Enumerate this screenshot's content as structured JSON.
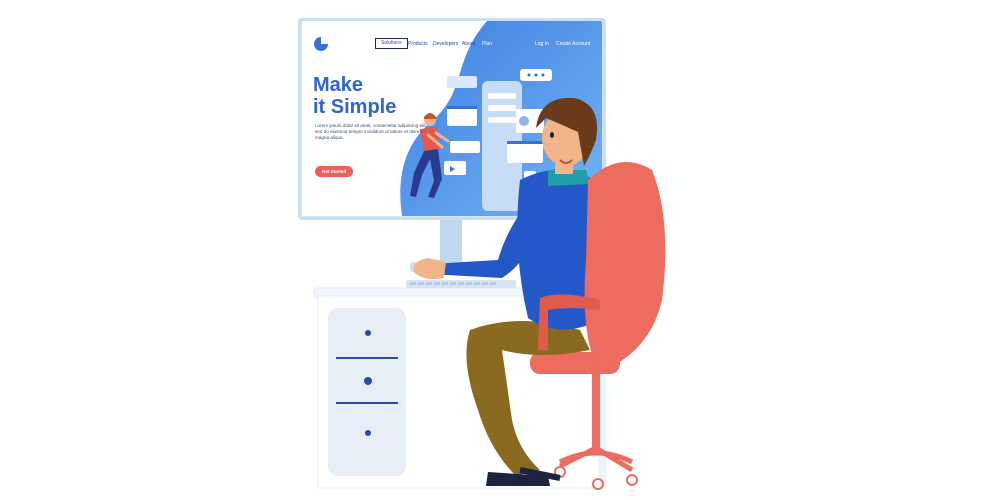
{
  "illustration": {
    "description_role": "person sitting at desk using computer"
  },
  "screen": {
    "nav": {
      "items": [
        {
          "label": "Solutions",
          "active": true
        },
        {
          "label": "Products",
          "active": false
        },
        {
          "label": "Developers",
          "active": false
        },
        {
          "label": "About",
          "active": false
        },
        {
          "label": "Plan",
          "active": false
        }
      ],
      "login": "Log In",
      "create_account": "Create Account"
    },
    "hero": {
      "title_line1": "Make",
      "title_line2": "it Simple",
      "body": "Lorem ipsum dolor sit amet, consectetur adipiscing elit, sed do eiusmod tempor incididunt ut labore et dolore magna aliqua.",
      "cta_label": "Get Started"
    }
  },
  "colors": {
    "accent_blue": "#2f64d6",
    "cta_red": "#f0605a",
    "chair_red": "#ee6b5f",
    "shirt_blue": "#2458c8",
    "pants_olive": "#8a6a1e"
  }
}
